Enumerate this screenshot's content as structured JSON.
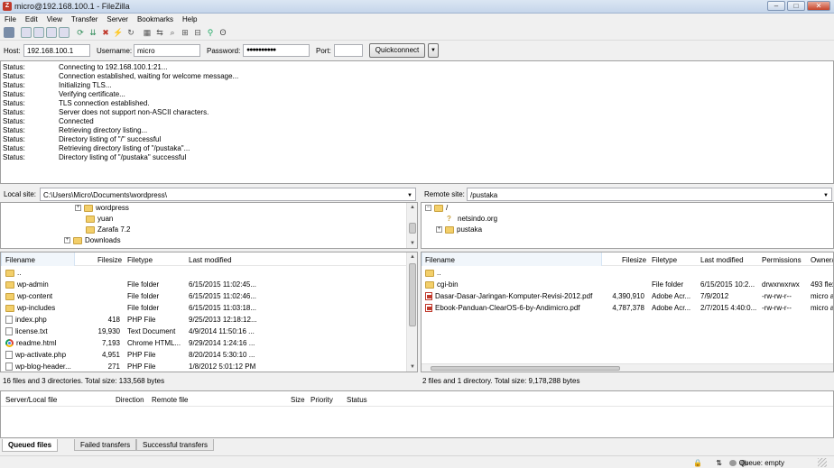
{
  "window": {
    "title": "micro@192.168.100.1 - FileZilla",
    "app_icon": "Z"
  },
  "menu": [
    "File",
    "Edit",
    "View",
    "Transfer",
    "Server",
    "Bookmarks",
    "Help"
  ],
  "quickconnect": {
    "host_label": "Host:",
    "host_value": "192.168.100.1",
    "username_label": "Username:",
    "username_value": "micro",
    "password_label": "Password:",
    "password_value": "●●●●●●●●●●",
    "port_label": "Port:",
    "port_value": "",
    "button_label": "Quickconnect"
  },
  "log": [
    {
      "s": "Status:",
      "m": "Connecting to 192.168.100.1:21..."
    },
    {
      "s": "Status:",
      "m": "Connection established, waiting for welcome message..."
    },
    {
      "s": "Status:",
      "m": "Initializing TLS..."
    },
    {
      "s": "Status:",
      "m": "Verifying certificate..."
    },
    {
      "s": "Status:",
      "m": "TLS connection established."
    },
    {
      "s": "Status:",
      "m": "Server does not support non-ASCII characters."
    },
    {
      "s": "Status:",
      "m": "Connected"
    },
    {
      "s": "Status:",
      "m": "Retrieving directory listing..."
    },
    {
      "s": "Status:",
      "m": "Directory listing of \"/\" successful"
    },
    {
      "s": "Status:",
      "m": "Retrieving directory listing of \"/pustaka\"..."
    },
    {
      "s": "Status:",
      "m": "Directory listing of \"/pustaka\" successful"
    }
  ],
  "local": {
    "site_label": "Local site:",
    "path": "C:\\Users\\Micro\\Documents\\wordpress\\",
    "tree": [
      "wordpress",
      "yuan",
      "Zarafa 7.2",
      "Downloads"
    ],
    "columns": [
      "Filename",
      "Filesize",
      "Filetype",
      "Last modified"
    ],
    "rows": [
      {
        "name": "..",
        "size": "",
        "type": "",
        "modified": ""
      },
      {
        "name": "wp-admin",
        "size": "",
        "type": "File folder",
        "modified": "6/15/2015 11:02:45..."
      },
      {
        "name": "wp-content",
        "size": "",
        "type": "File folder",
        "modified": "6/15/2015 11:02:46..."
      },
      {
        "name": "wp-includes",
        "size": "",
        "type": "File folder",
        "modified": "6/15/2015 11:03:18..."
      },
      {
        "name": "index.php",
        "size": "418",
        "type": "PHP File",
        "modified": "9/25/2013 12:18:12..."
      },
      {
        "name": "license.txt",
        "size": "19,930",
        "type": "Text Document",
        "modified": "4/9/2014 11:50:16 ..."
      },
      {
        "name": "readme.html",
        "size": "7,193",
        "type": "Chrome HTML...",
        "modified": "9/29/2014 1:24:16 ..."
      },
      {
        "name": "wp-activate.php",
        "size": "4,951",
        "type": "PHP File",
        "modified": "8/20/2014 5:30:10 ..."
      },
      {
        "name": "wp-blog-header...",
        "size": "271",
        "type": "PHP File",
        "modified": "1/8/2012 5:01:12 PM"
      }
    ],
    "summary": "16 files and 3 directories. Total size: 133,568 bytes"
  },
  "remote": {
    "site_label": "Remote site:",
    "path": "/pustaka",
    "tree": [
      "/",
      "netsindo.org",
      "pustaka"
    ],
    "columns": [
      "Filename",
      "Filesize",
      "Filetype",
      "Last modified",
      "Permissions",
      "Owner/"
    ],
    "rows": [
      {
        "name": "..",
        "size": "",
        "type": "",
        "modified": "",
        "perm": "",
        "owner": ""
      },
      {
        "name": "cgi-bin",
        "size": "",
        "type": "File folder",
        "modified": "6/15/2015 10:2...",
        "perm": "drwxrwxrwx",
        "owner": "493 flex"
      },
      {
        "name": "Dasar-Dasar-Jaringan-Komputer-Revisi-2012.pdf",
        "size": "4,390,910",
        "type": "Adobe Acr...",
        "modified": "7/9/2012",
        "perm": "-rw-rw-r--",
        "owner": "micro a"
      },
      {
        "name": "Ebook-Panduan-ClearOS-6-by-Andimicro.pdf",
        "size": "4,787,378",
        "type": "Adobe Acr...",
        "modified": "2/7/2015 4:40:0...",
        "perm": "-rw-rw-r--",
        "owner": "micro a"
      }
    ],
    "summary": "2 files and 1 directory. Total size: 9,178,288 bytes"
  },
  "queue": {
    "columns": [
      "Server/Local file",
      "Direction",
      "Remote file",
      "Size",
      "Priority",
      "Status"
    ],
    "tabs": [
      "Queued files",
      "Failed transfers",
      "Successful transfers"
    ],
    "status": "Queue: empty"
  }
}
